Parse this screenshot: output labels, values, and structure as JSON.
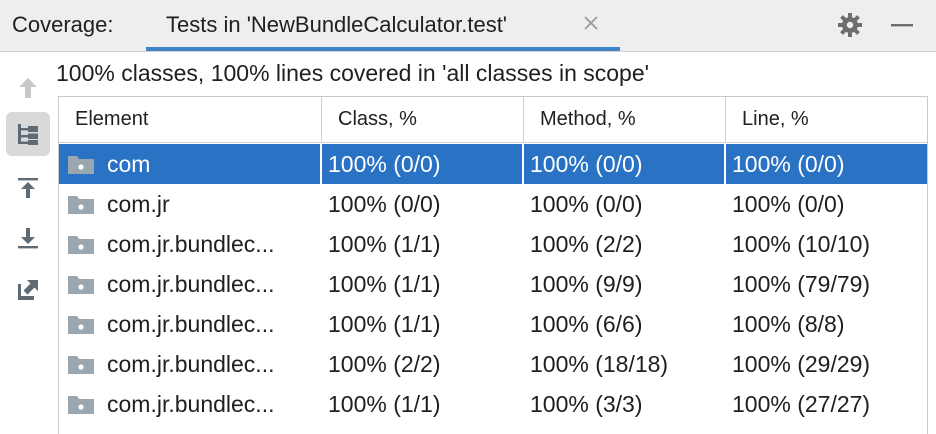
{
  "header": {
    "title": "Coverage:",
    "tab_label": "Tests in 'NewBundleCalculator.test'"
  },
  "toolbar": {
    "icons": [
      "arrow-up-icon",
      "flatten-packages-icon",
      "import-icon",
      "export-icon",
      "open-external-icon"
    ]
  },
  "summary": "100% classes, 100% lines covered in 'all classes in scope'",
  "table": {
    "columns": [
      "Element",
      "Class, %",
      "Method, %",
      "Line, %"
    ],
    "rows": [
      {
        "element": "com",
        "class": "100% (0/0)",
        "method": "100% (0/0)",
        "line": "100% (0/0)",
        "selected": true
      },
      {
        "element": "com.jr",
        "class": "100% (0/0)",
        "method": "100% (0/0)",
        "line": "100% (0/0)",
        "selected": false
      },
      {
        "element": "com.jr.bundlec...",
        "class": "100% (1/1)",
        "method": "100% (2/2)",
        "line": "100% (10/10)",
        "selected": false
      },
      {
        "element": "com.jr.bundlec...",
        "class": "100% (1/1)",
        "method": "100% (9/9)",
        "line": "100% (79/79)",
        "selected": false
      },
      {
        "element": "com.jr.bundlec...",
        "class": "100% (1/1)",
        "method": "100% (6/6)",
        "line": "100% (8/8)",
        "selected": false
      },
      {
        "element": "com.jr.bundlec...",
        "class": "100% (2/2)",
        "method": "100% (18/18)",
        "line": "100% (29/29)",
        "selected": false
      },
      {
        "element": "com.jr.bundlec...",
        "class": "100% (1/1)",
        "method": "100% (3/3)",
        "line": "100% (27/27)",
        "selected": false
      }
    ]
  },
  "colors": {
    "selection": "#2a72c4",
    "tab_underline": "#4083c9",
    "folder": "#9aa7b0"
  }
}
